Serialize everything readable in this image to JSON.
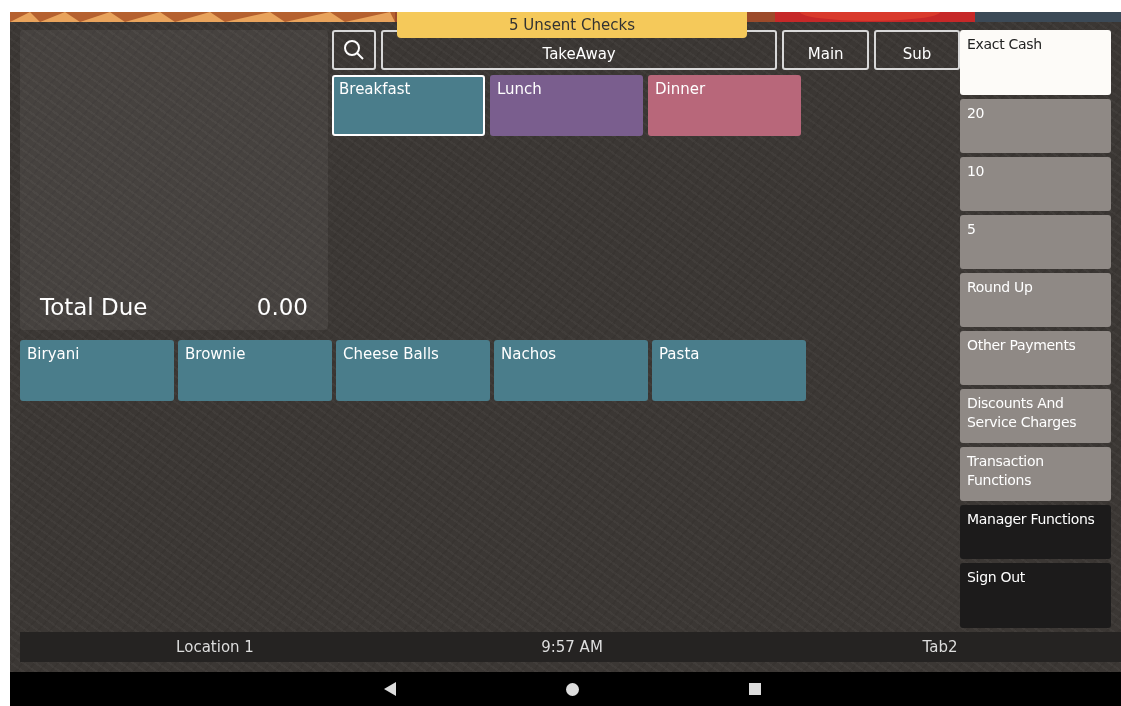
{
  "banner": {
    "text": "5 Unsent Checks"
  },
  "check": {
    "total_label": "Total Due",
    "total_value": "0.00"
  },
  "toolbar": {
    "order_type": "TakeAway",
    "buttons": [
      "Main",
      "Sub"
    ]
  },
  "categories": [
    {
      "label": "Breakfast",
      "color": "#4a7d8b",
      "selected": true
    },
    {
      "label": "Lunch",
      "color": "#7a5e8e",
      "selected": false
    },
    {
      "label": "Dinner",
      "color": "#b8677a",
      "selected": false
    }
  ],
  "items": [
    {
      "label": "Biryani",
      "color": "#4a7d8b"
    },
    {
      "label": "Brownie",
      "color": "#4a7d8b"
    },
    {
      "label": "Cheese Balls",
      "color": "#4a7d8b"
    },
    {
      "label": "Nachos",
      "color": "#4a7d8b"
    },
    {
      "label": "Pasta",
      "color": "#4a7d8b"
    }
  ],
  "functions": [
    {
      "label": "Exact Cash",
      "kind": "highlight"
    },
    {
      "label": "20",
      "kind": "payment"
    },
    {
      "label": "10",
      "kind": "payment"
    },
    {
      "label": "5",
      "kind": "payment"
    },
    {
      "label": "Round Up",
      "kind": "payment"
    },
    {
      "label": "Other Payments",
      "kind": "payment"
    },
    {
      "label": "Discounts And Service Charges",
      "kind": "payment"
    },
    {
      "label": "Transaction Functions",
      "kind": "payment"
    },
    {
      "label": "Manager Functions",
      "kind": "dark"
    },
    {
      "label": "Sign Out",
      "kind": "dark"
    }
  ],
  "status_bar": {
    "location": "Location 1",
    "time": "9:57 AM",
    "tab": "Tab2"
  }
}
